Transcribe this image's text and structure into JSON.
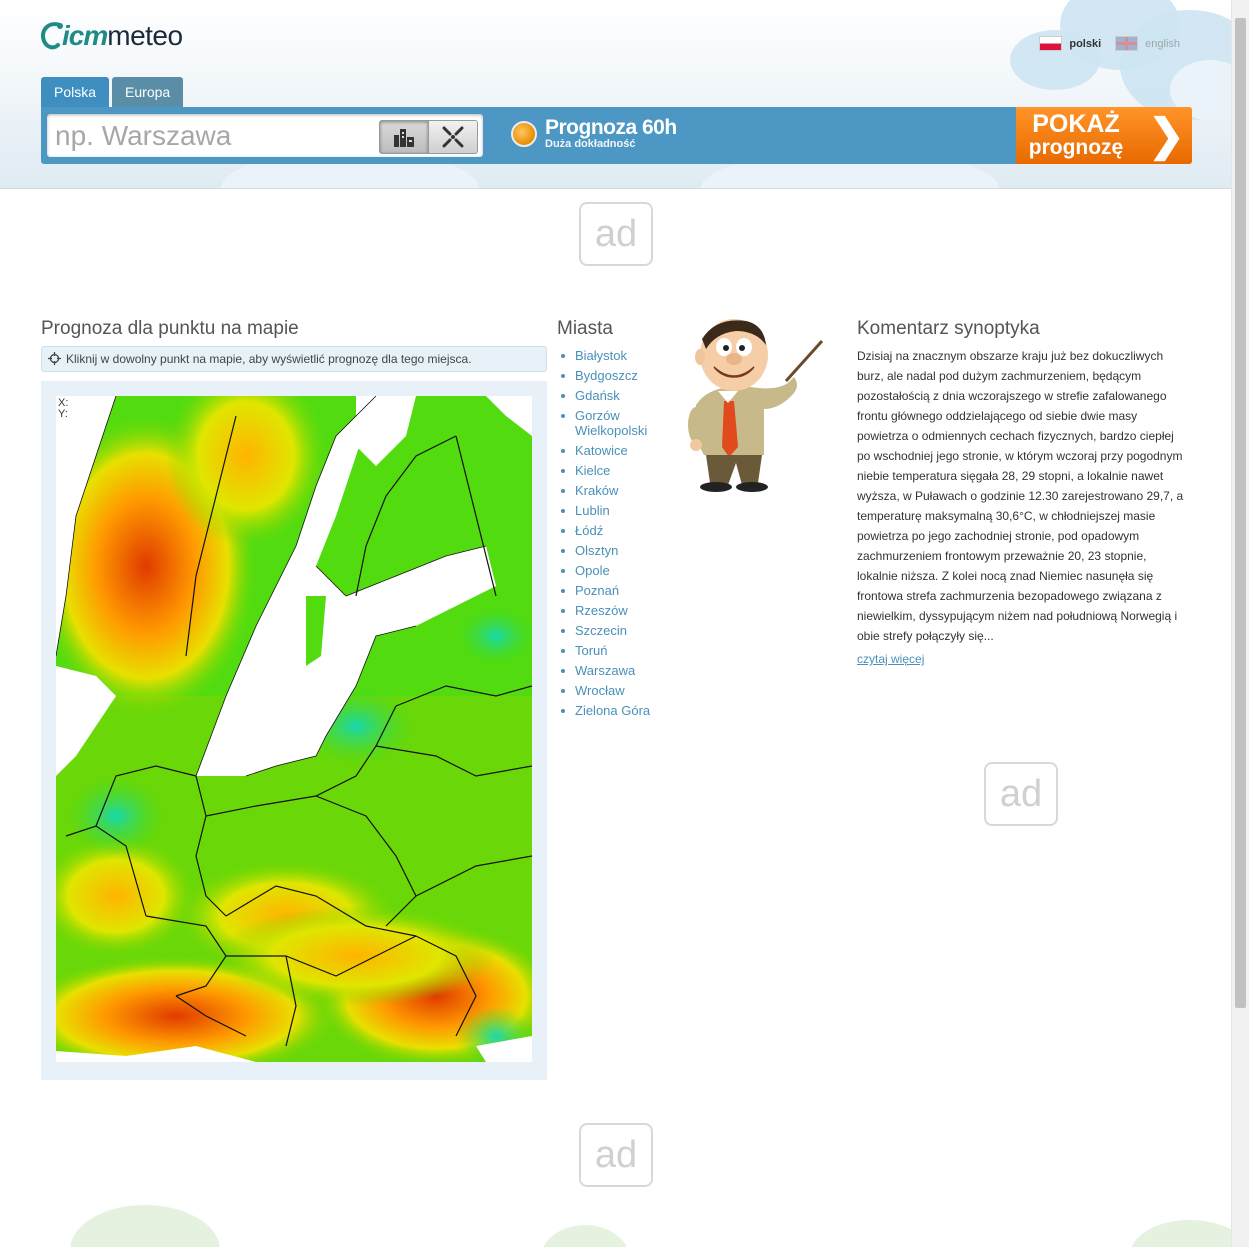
{
  "logo": {
    "part1": "icm",
    "part2": "meteo"
  },
  "languages": [
    {
      "label": "polski",
      "active": true
    },
    {
      "label": "english",
      "active": false
    }
  ],
  "tabs": [
    {
      "label": "Polska",
      "active": true
    },
    {
      "label": "Europa",
      "active": false
    }
  ],
  "search": {
    "placeholder": "np. Warszawa",
    "modes": [
      {
        "icon": "city-buildings-icon",
        "active": true
      },
      {
        "icon": "map-point-crosshair-icon",
        "active": false
      }
    ]
  },
  "model": {
    "title": "Prognoza 60h",
    "subtitle": "Duża dokładność",
    "color": "#f0a020"
  },
  "show_button": {
    "line1": "POKAŻ",
    "line2": "prognozę",
    "arrow": "❯",
    "color": "#f07c10"
  },
  "ads": {
    "label": "ad"
  },
  "map_section": {
    "title": "Prognoza dla punktu na mapie",
    "hint": "Kliknij w dowolny punkt na mapie, aby wyświetlić prognozę dla tego miejsca.",
    "coord_x": "X:",
    "coord_y": "Y:"
  },
  "cities": {
    "title": "Miasta",
    "items": [
      "Białystok",
      "Bydgoszcz",
      "Gdańsk",
      "Gorzów Wielkopolski",
      "Katowice",
      "Kielce",
      "Kraków",
      "Lublin",
      "Łódź",
      "Olsztyn",
      "Opole",
      "Poznań",
      "Rzeszów",
      "Szczecin",
      "Toruń",
      "Warszawa",
      "Wrocław",
      "Zielona Góra"
    ]
  },
  "commentary": {
    "title": "Komentarz synoptyka",
    "text": "Dzisiaj na znacznym obszarze kraju już bez dokuczliwych burz, ale nadal pod dużym zachmurzeniem, będącym pozostałością z dnia wczorajszego w strefie zafalowanego frontu głównego oddzielającego od siebie dwie masy powietrza o odmiennych cechach fizycznych, bardzo ciepłej po wschodniej jego stronie, w którym wczoraj przy pogodnym niebie temperatura sięgała 28, 29 stopni, a lokalnie nawet wyższa, w Puławach o godzinie 12.30 zarejestrowano 29,7, a temperaturę maksymalną 30,6°C, w chłodniejszej masie powietrza po jego zachodniej stronie, pod opadowym zachmurzeniem frontowym przeważnie 20, 23 stopnie, lokalnie niższa. Z kolei nocą znad Niemiec nasunęła się frontowa strefa zachmurzenia bezopadowego związana z niewielkim, dyssypującym niżem nad południową Norwegią i obie strefy połączyły się...",
    "read_more": "czytaj więcej"
  },
  "colors": {
    "link": "#4a90b8",
    "header_bar": "#4d97c4",
    "tab_active": "#3e8fc0",
    "accent_orange": "#f07c10"
  }
}
